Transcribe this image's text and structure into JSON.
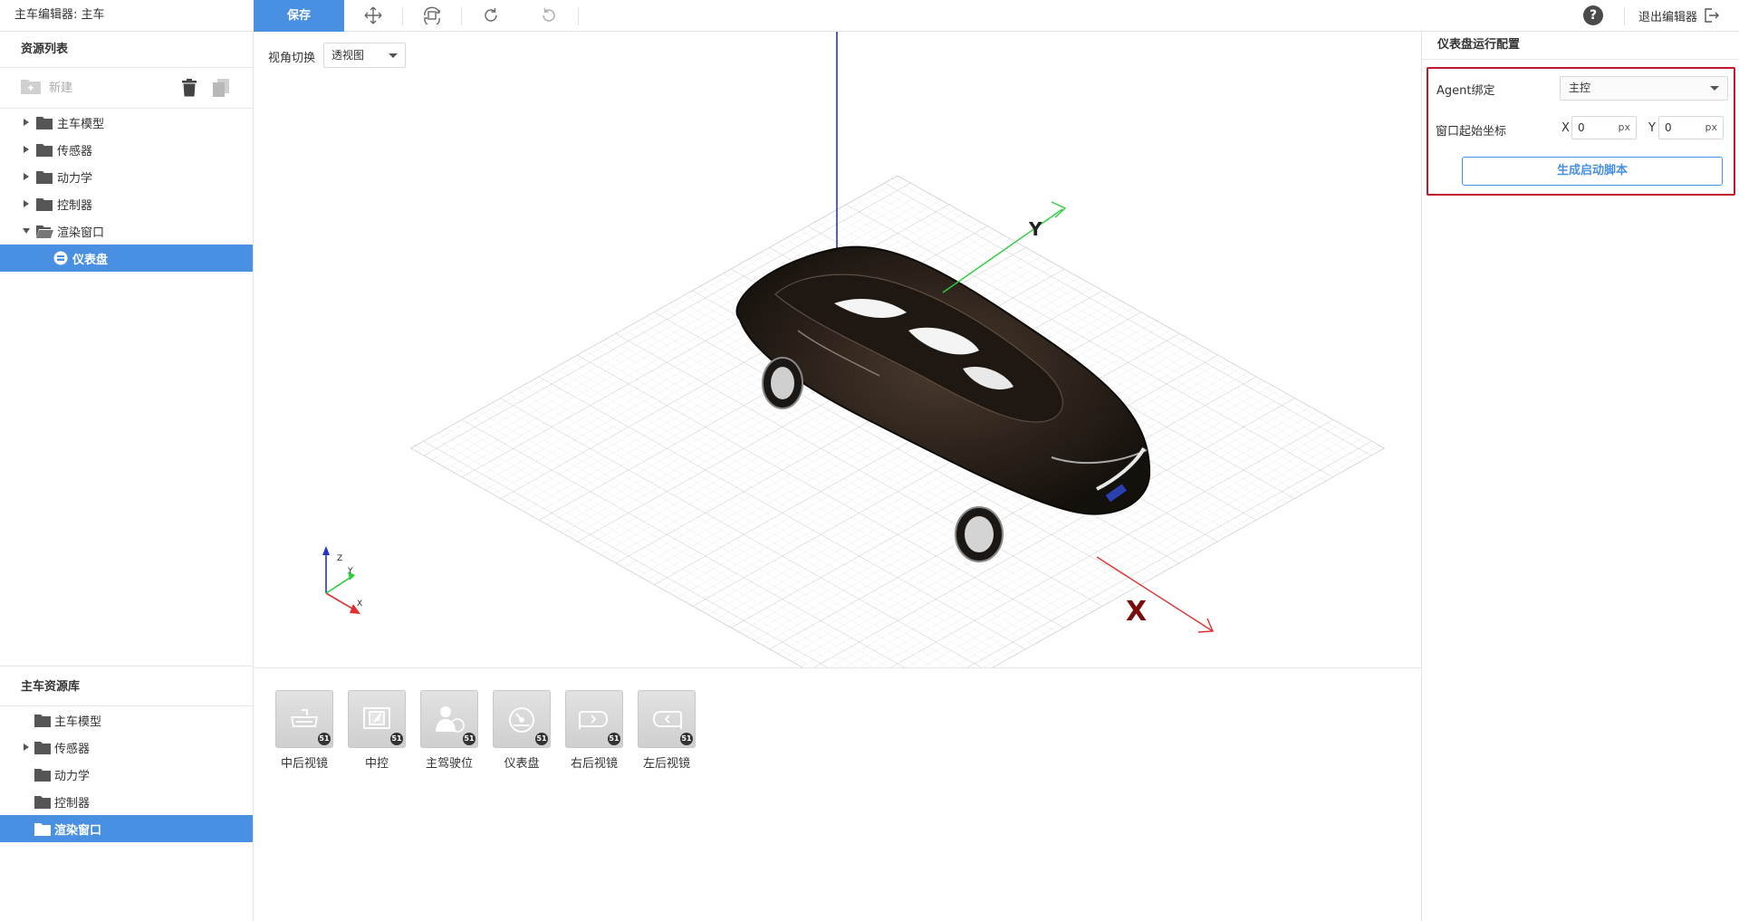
{
  "app": {
    "title": "主车编辑器: 主车"
  },
  "toolbar": {
    "save_label": "保存",
    "tools": [
      "move-icon",
      "rotate-view-icon",
      "redo-icon",
      "undo-icon"
    ],
    "help_label": "?",
    "exit_label": "退出编辑器"
  },
  "resource_list": {
    "title": "资源列表",
    "new_label": "新建",
    "items": [
      {
        "label": "主车模型",
        "expanded": false
      },
      {
        "label": "传感器",
        "expanded": false
      },
      {
        "label": "动力学",
        "expanded": false
      },
      {
        "label": "控制器",
        "expanded": false
      },
      {
        "label": "渲染窗口",
        "expanded": true
      }
    ],
    "child": {
      "label": "仪表盘",
      "selected": true
    }
  },
  "library": {
    "title": "主车资源库",
    "items": [
      {
        "label": "主车模型",
        "has_children": false
      },
      {
        "label": "传感器",
        "has_children": true
      },
      {
        "label": "动力学",
        "has_children": false
      },
      {
        "label": "控制器",
        "has_children": false
      },
      {
        "label": "渲染窗口",
        "has_children": false,
        "selected": true
      }
    ]
  },
  "viewport": {
    "view_switch_label": "视角切换",
    "view_mode": "透视图",
    "axis_labels": {
      "x": "X",
      "y": "Y",
      "z": "Z"
    }
  },
  "assets": [
    {
      "label": "中后视镜",
      "icon": "rearview-mirror-icon",
      "badge": "51"
    },
    {
      "label": "中控",
      "icon": "center-console-icon",
      "badge": "51"
    },
    {
      "label": "主驾驶位",
      "icon": "driver-seat-icon",
      "badge": "51"
    },
    {
      "label": "仪表盘",
      "icon": "dashboard-gauge-icon",
      "badge": "51"
    },
    {
      "label": "右后视镜",
      "icon": "right-mirror-icon",
      "badge": "51"
    },
    {
      "label": "左后视镜",
      "icon": "left-mirror-icon",
      "badge": "51"
    }
  ],
  "run_config": {
    "title": "仪表盘运行配置",
    "agent_label": "Agent绑定",
    "agent_value": "主控",
    "origin_label": "窗口起始坐标",
    "x_label": "X",
    "x_value": "0",
    "y_label": "Y",
    "y_value": "0",
    "unit": "px",
    "generate_label": "生成启动脚本"
  },
  "colors": {
    "accent": "#4a90e2",
    "highlight_border": "#c0192c",
    "axis_x": "#e03030",
    "axis_y": "#2ecc40",
    "axis_z": "#2233cc"
  }
}
